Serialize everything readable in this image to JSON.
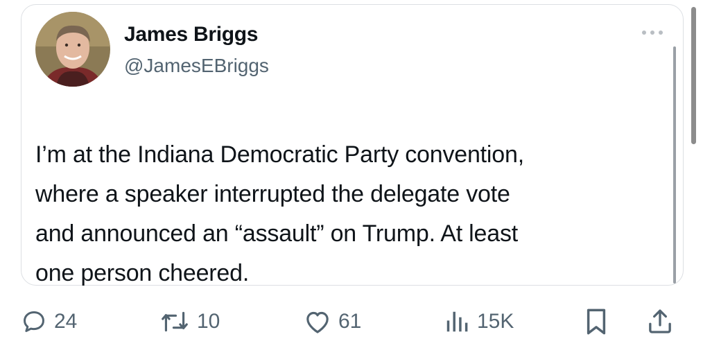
{
  "tweet": {
    "author_name": "James Briggs",
    "author_handle": "@JamesEBriggs",
    "lines": [
      "I’m at the Indiana Democratic Party convention,",
      "where a speaker interrupted the delegate vote",
      "and announced an “assault” on Trump. At least",
      "one person cheered."
    ]
  },
  "actions": {
    "replies": "24",
    "reposts": "10",
    "likes": "61",
    "views": "15K"
  },
  "icons": {
    "reply": "speech-bubble-icon",
    "repost": "repost-arrows-icon",
    "like": "heart-icon",
    "views": "bar-chart-icon",
    "bookmark": "bookmark-icon",
    "share": "share-upload-icon",
    "more": "ellipsis-icon"
  },
  "colors": {
    "text": "#0f1419",
    "secondary": "#536471",
    "border": "#dcdfe3"
  }
}
